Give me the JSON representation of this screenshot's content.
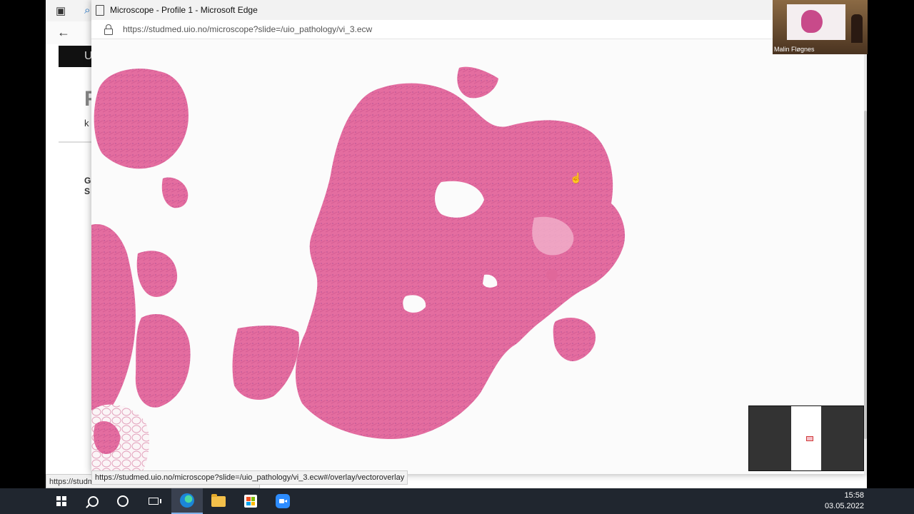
{
  "popup": {
    "window_title": "Microscope - Profile 1 - Microsoft Edge",
    "address_url": "https://studmed.uio.no/microscope?slide=/uio_pathology/vi_3.ecw",
    "link_preview": "https://studmed.uio.no/microscope?slide=/uio_pathology/vi_3.ecw#/overlay/vectoroverlay"
  },
  "background_page": {
    "logo_fragment": "U",
    "heading_fragment": "F",
    "sub_fragment": "k",
    "line_fragment_1": "G",
    "line_fragment_2": "S",
    "status_url": "https://studmed.uio.no/..."
  },
  "webcam": {
    "participant_name": "Malin Fløgnes"
  },
  "taskbar": {
    "time": "15:58",
    "date": "03.05.2022"
  },
  "colors": {
    "tissue": "#e0679a",
    "tissue_dark": "#c04a86",
    "taskbar": "#20262f"
  }
}
